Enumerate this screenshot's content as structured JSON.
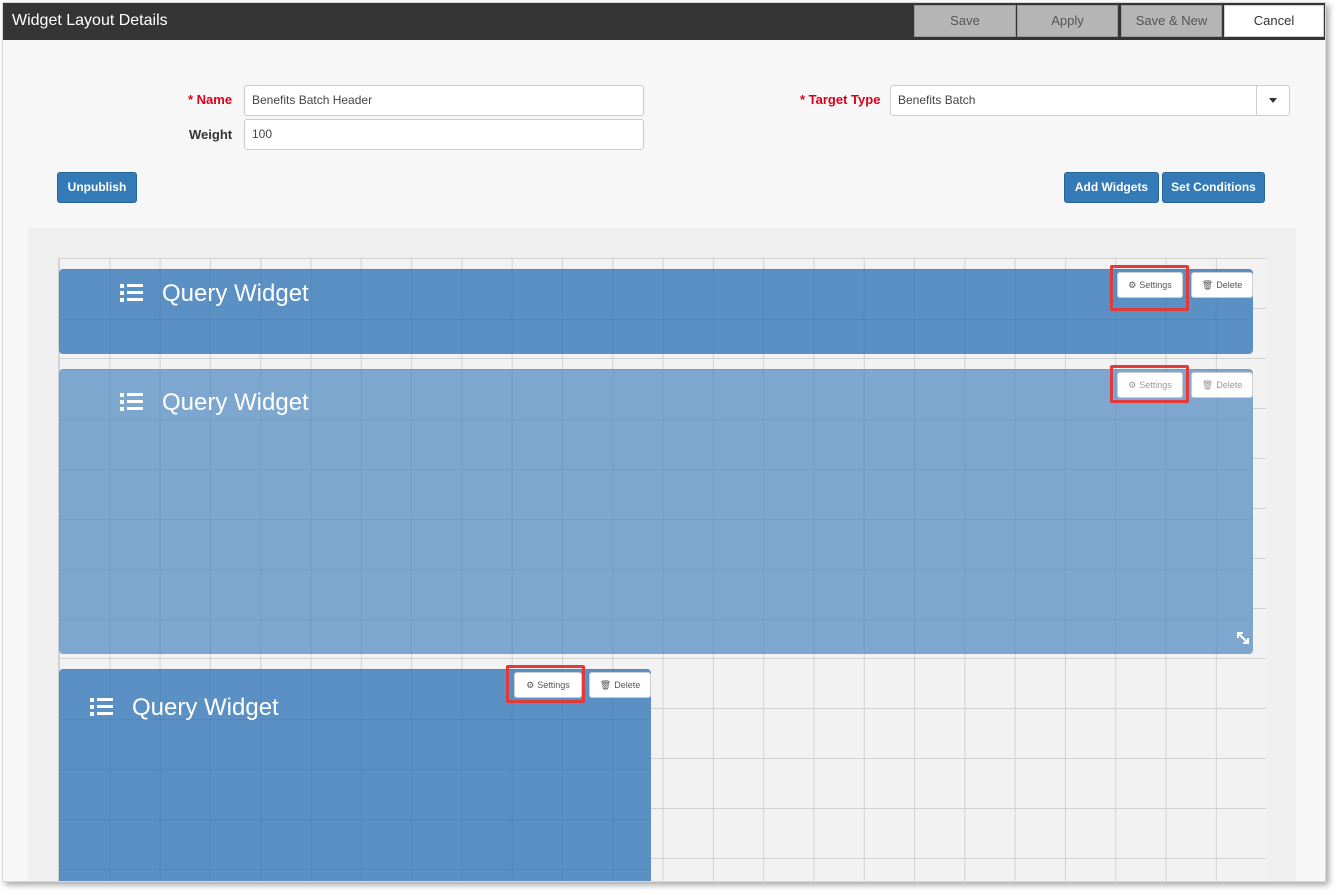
{
  "window": {
    "title": "Widget Layout Details"
  },
  "toolbar": {
    "save_label": "Save",
    "apply_label": "Apply",
    "save_new_label": "Save & New",
    "cancel_label": "Cancel"
  },
  "form": {
    "name": {
      "required_mark": "* ",
      "label": "Name",
      "value": "Benefits Batch Header"
    },
    "weight": {
      "label": "Weight",
      "value": "100"
    },
    "target_type": {
      "required_mark": "* ",
      "label": "Target Type",
      "value": "Benefits Batch"
    }
  },
  "actions": {
    "unpublish_label": "Unpublish",
    "add_widgets_label": "Add Widgets",
    "set_conditions_label": "Set Conditions"
  },
  "widgets": [
    {
      "title": "Query Widget",
      "icon": "list-icon",
      "settings_label": "Settings",
      "delete_label": "Delete",
      "color": "#5a90c4",
      "delete_state": "normal",
      "settings_highlighted": true
    },
    {
      "title": "Query Widget",
      "icon": "list-icon",
      "settings_label": "Settings",
      "delete_label": "Delete",
      "color": "#7da7cf",
      "delete_state": "faded",
      "settings_highlighted": true,
      "resize_icon": "resize-icon"
    },
    {
      "title": "Query Widget",
      "icon": "list-icon",
      "settings_label": "Settings",
      "delete_label": "Delete",
      "color": "#5a90c4",
      "delete_state": "normal",
      "settings_highlighted": true
    }
  ],
  "icons": {
    "settings": "gear-icon",
    "delete": "trash-icon"
  },
  "colors": {
    "primary": "#337ab7",
    "highlight": "#e03a3a",
    "titlebar": "#353535",
    "required": "#d9001b"
  }
}
